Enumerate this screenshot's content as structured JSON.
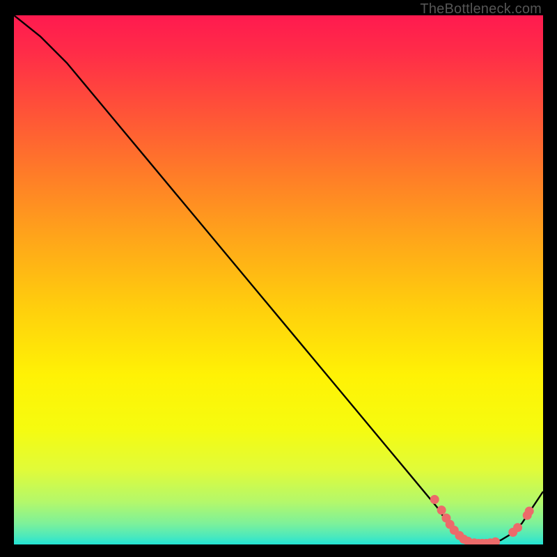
{
  "watermark": "TheBottleneck.com",
  "chart_data": {
    "type": "line",
    "title": "",
    "xlabel": "",
    "ylabel": "",
    "xlim": [
      0,
      100
    ],
    "ylim": [
      0,
      100
    ],
    "grid": false,
    "legend": false,
    "series": [
      {
        "name": "curve",
        "x": [
          0,
          5,
          10,
          15,
          20,
          25,
          30,
          35,
          40,
          45,
          50,
          55,
          60,
          65,
          70,
          75,
          80,
          82,
          84,
          86,
          88,
          90,
          92,
          94,
          96,
          98,
          100
        ],
        "y": [
          100,
          96,
          91,
          85,
          79,
          73,
          67,
          61,
          55,
          49,
          43,
          37,
          31,
          25,
          19,
          13,
          7,
          4,
          2,
          1,
          0.4,
          0.4,
          0.8,
          2,
          4,
          7,
          10
        ]
      }
    ],
    "markers": [
      {
        "x": 79.5,
        "y": 8.5
      },
      {
        "x": 80.8,
        "y": 6.5
      },
      {
        "x": 81.7,
        "y": 5.0
      },
      {
        "x": 82.4,
        "y": 3.8
      },
      {
        "x": 83.2,
        "y": 2.7
      },
      {
        "x": 84.2,
        "y": 1.7
      },
      {
        "x": 85.0,
        "y": 1.0
      },
      {
        "x": 85.8,
        "y": 0.6
      },
      {
        "x": 87.0,
        "y": 0.3
      },
      {
        "x": 87.8,
        "y": 0.2
      },
      {
        "x": 88.5,
        "y": 0.2
      },
      {
        "x": 89.2,
        "y": 0.2
      },
      {
        "x": 90.0,
        "y": 0.3
      },
      {
        "x": 91.0,
        "y": 0.5
      },
      {
        "x": 94.3,
        "y": 2.3
      },
      {
        "x": 95.2,
        "y": 3.2
      },
      {
        "x": 97.0,
        "y": 5.5
      },
      {
        "x": 97.4,
        "y": 6.3
      }
    ],
    "gradient_stops": [
      {
        "offset": 0.0,
        "color": "#ff1a4f"
      },
      {
        "offset": 0.07,
        "color": "#ff2c48"
      },
      {
        "offset": 0.18,
        "color": "#ff5238"
      },
      {
        "offset": 0.3,
        "color": "#ff7c28"
      },
      {
        "offset": 0.42,
        "color": "#ffa51a"
      },
      {
        "offset": 0.55,
        "color": "#ffce0d"
      },
      {
        "offset": 0.68,
        "color": "#fff205"
      },
      {
        "offset": 0.78,
        "color": "#f6fb0f"
      },
      {
        "offset": 0.86,
        "color": "#e0fb3a"
      },
      {
        "offset": 0.92,
        "color": "#b3f86b"
      },
      {
        "offset": 0.96,
        "color": "#7ef199"
      },
      {
        "offset": 0.985,
        "color": "#4be9bd"
      },
      {
        "offset": 1.0,
        "color": "#22e3d4"
      }
    ],
    "marker_color": "#ec6a6a",
    "curve_color": "#000000"
  }
}
